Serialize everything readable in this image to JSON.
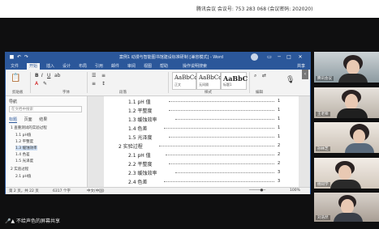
{
  "meeting": {
    "info": "腾讯会议 会议号: 753 283 068  (会议密码: 202020)"
  },
  "word": {
    "title": "案例1 动漫与智能图书馆建设标准研制 [兼容模式] - Word",
    "ribbon_tabs": [
      "文件",
      "开始",
      "插入",
      "设计",
      "布局",
      "引用",
      "邮件",
      "审阅",
      "视图",
      "帮助",
      "操作说明搜索"
    ],
    "active_tab": "开始",
    "share": "共享",
    "groups": [
      "剪贴板",
      "字体",
      "段落",
      "样式",
      "编辑"
    ],
    "styles": [
      {
        "sample": "AaBbCcI",
        "name": "正文"
      },
      {
        "sample": "AaBbCcI",
        "name": "无间隔"
      },
      {
        "sample": "AaBbC",
        "name": "标题1"
      }
    ],
    "nav": {
      "title": "导航",
      "search_placeholder": "在文档中搜索",
      "tabs": [
        "标题",
        "页面",
        "结果"
      ],
      "items": [
        "1 查重测试的实验过程",
        "1.1 pH值",
        "1.2 平整度",
        "1.3 缓蚀效率",
        "1.4 色差",
        "1.5 光泽度",
        "2 实验过程",
        "2.1 pH值"
      ]
    },
    "toc": [
      {
        "text": "1.1 pH 值",
        "page": "1"
      },
      {
        "text": "1.2 平整度",
        "page": "1"
      },
      {
        "text": "1.3 缓蚀效率",
        "page": "1"
      },
      {
        "text": "1.4 色差",
        "page": "1"
      },
      {
        "text": "1.5 光泽度",
        "page": "1"
      },
      {
        "text": "2 实验过程",
        "page": "2"
      },
      {
        "text": "2.1 pH 值",
        "page": "2"
      },
      {
        "text": "2.2 平整度",
        "page": "2"
      },
      {
        "text": "2.3 缓蚀效率",
        "page": "3"
      },
      {
        "text": "2.4 色差",
        "page": "3"
      }
    ],
    "status": {
      "page": "第 2 页，共 22 页",
      "words": "6317 个字",
      "lang": "中文(中国)",
      "zoom": "100%"
    }
  },
  "participants": [
    {
      "name": "腾讯会议"
    },
    {
      "name": "王老师"
    },
    {
      "name": "孙林芝"
    },
    {
      "name": "杨同学"
    },
    {
      "name": "刘浩然"
    }
  ],
  "bottom_note": "不给声色的屏幕共享"
}
